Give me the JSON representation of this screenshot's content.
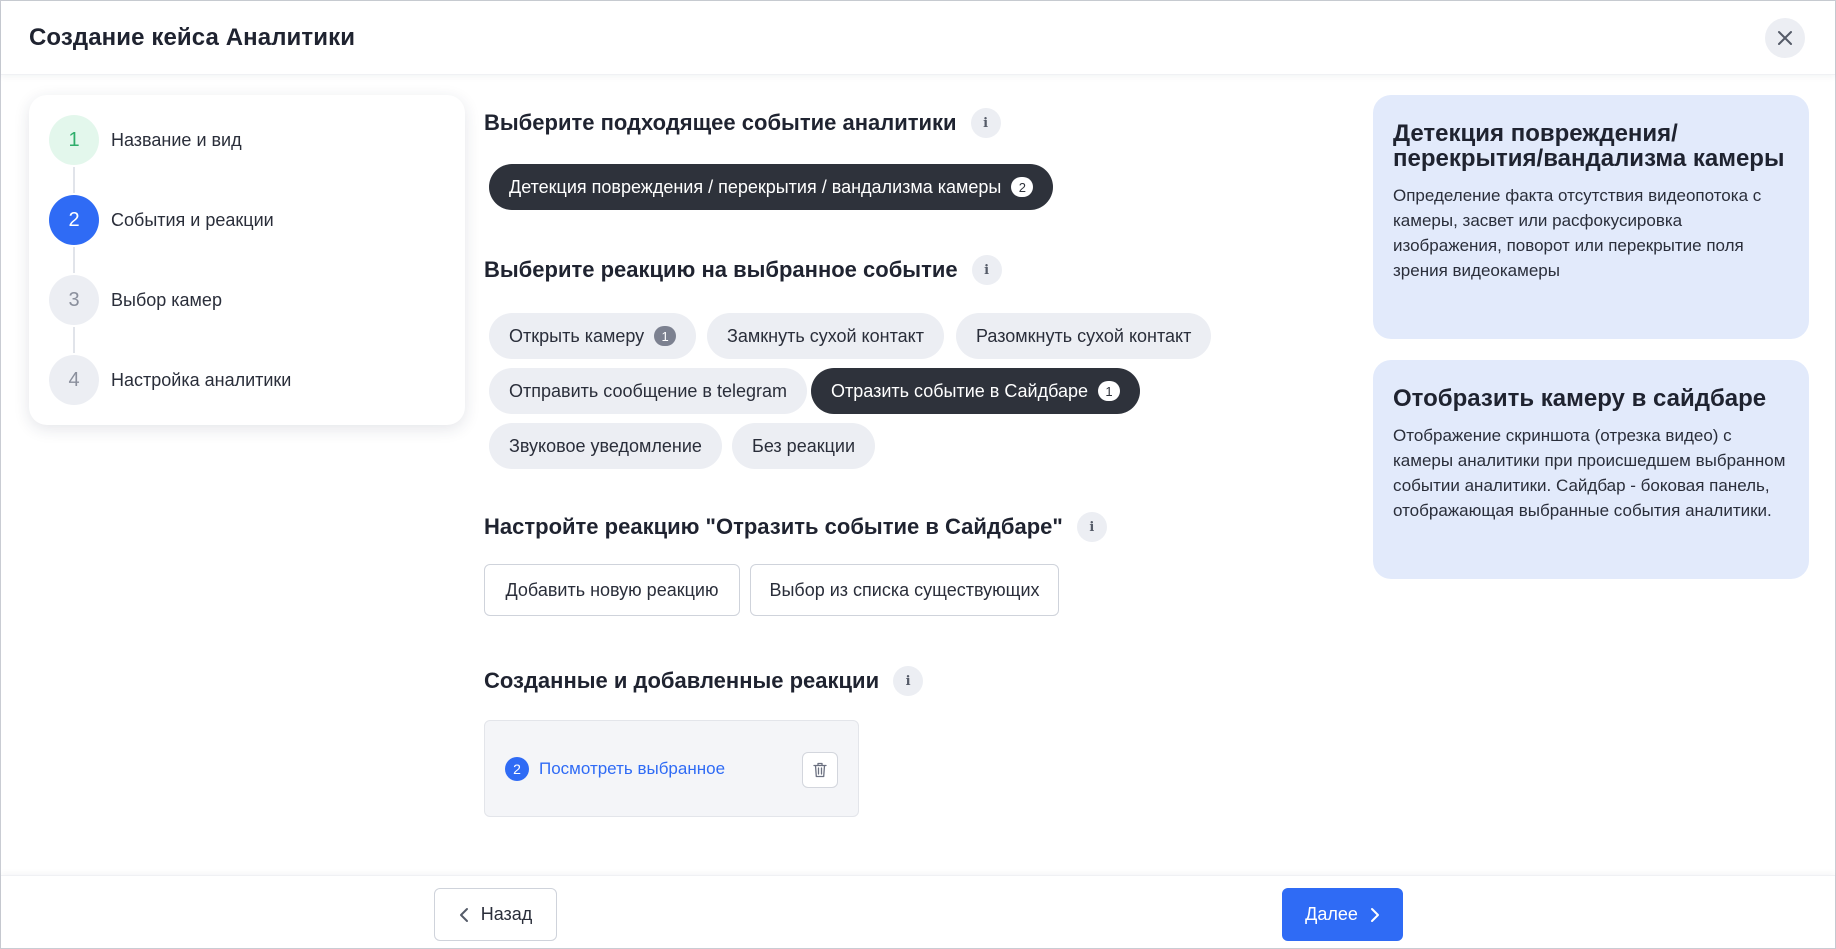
{
  "header": {
    "title": "Создание кейса Аналитики"
  },
  "stepper": {
    "steps": [
      {
        "num": "1",
        "label": "Название и вид",
        "state": "done"
      },
      {
        "num": "2",
        "label": "События и реакции",
        "state": "active"
      },
      {
        "num": "3",
        "label": "Выбор камер",
        "state": "pending"
      },
      {
        "num": "4",
        "label": "Настройка аналитики",
        "state": "pending"
      }
    ]
  },
  "event_section": {
    "title": "Выберите подходящее событие аналитики",
    "info": "i",
    "selected_event": {
      "label": "Детекция повреждения / перекрытия / вандализма камеры",
      "count": "2"
    }
  },
  "reaction_section": {
    "title": "Выберите реакцию на выбранное событие",
    "info": "i",
    "chips": [
      {
        "label": "Открыть камеру",
        "count": "1",
        "selected": false
      },
      {
        "label": "Замкнуть сухой контакт",
        "selected": false
      },
      {
        "label": "Разомкнуть сухой контакт",
        "selected": false
      },
      {
        "label": "Отправить сообщение в telegram",
        "selected": false
      },
      {
        "label": "Отразить событие в Сайдбаре",
        "count": "1",
        "selected": true
      },
      {
        "label": "Звуковое уведомление",
        "selected": false
      },
      {
        "label": "Без реакции",
        "selected": false
      }
    ]
  },
  "configure_section": {
    "title": "Настройте реакцию \"Отразить событие в Сайдбаре\"",
    "info": "i",
    "add_new_label": "Добавить новую реакцию",
    "choose_existing_label": "Выбор из списка существующих"
  },
  "created_section": {
    "title": "Созданные и добавленные реакции",
    "info": "i",
    "count": "2",
    "view_link": "Посмотреть выбранное"
  },
  "info_cards": [
    {
      "title": "Детекция повреждения/ перекрытия/вандализма камеры",
      "text": "Определение факта отсутствия видеопотока с камеры, засвет или расфокусировка изображения, поворот или перекрытие поля зрения видеокамеры"
    },
    {
      "title": "Отобразить камеру в сайдбаре",
      "text": "Отображение скриншота (отрезка видео) с камеры аналитики при происшедшем выбранном событии аналитики. Сайдбар - боковая панель, отображающая выбранные события аналитики."
    }
  ],
  "footer": {
    "back_label": "Назад",
    "next_label": "Далее"
  },
  "colors": {
    "accent": "#2f6bf5",
    "done": "#2fae6b",
    "card_bg": "#e2eafb",
    "chip_dark": "#2e323b"
  }
}
